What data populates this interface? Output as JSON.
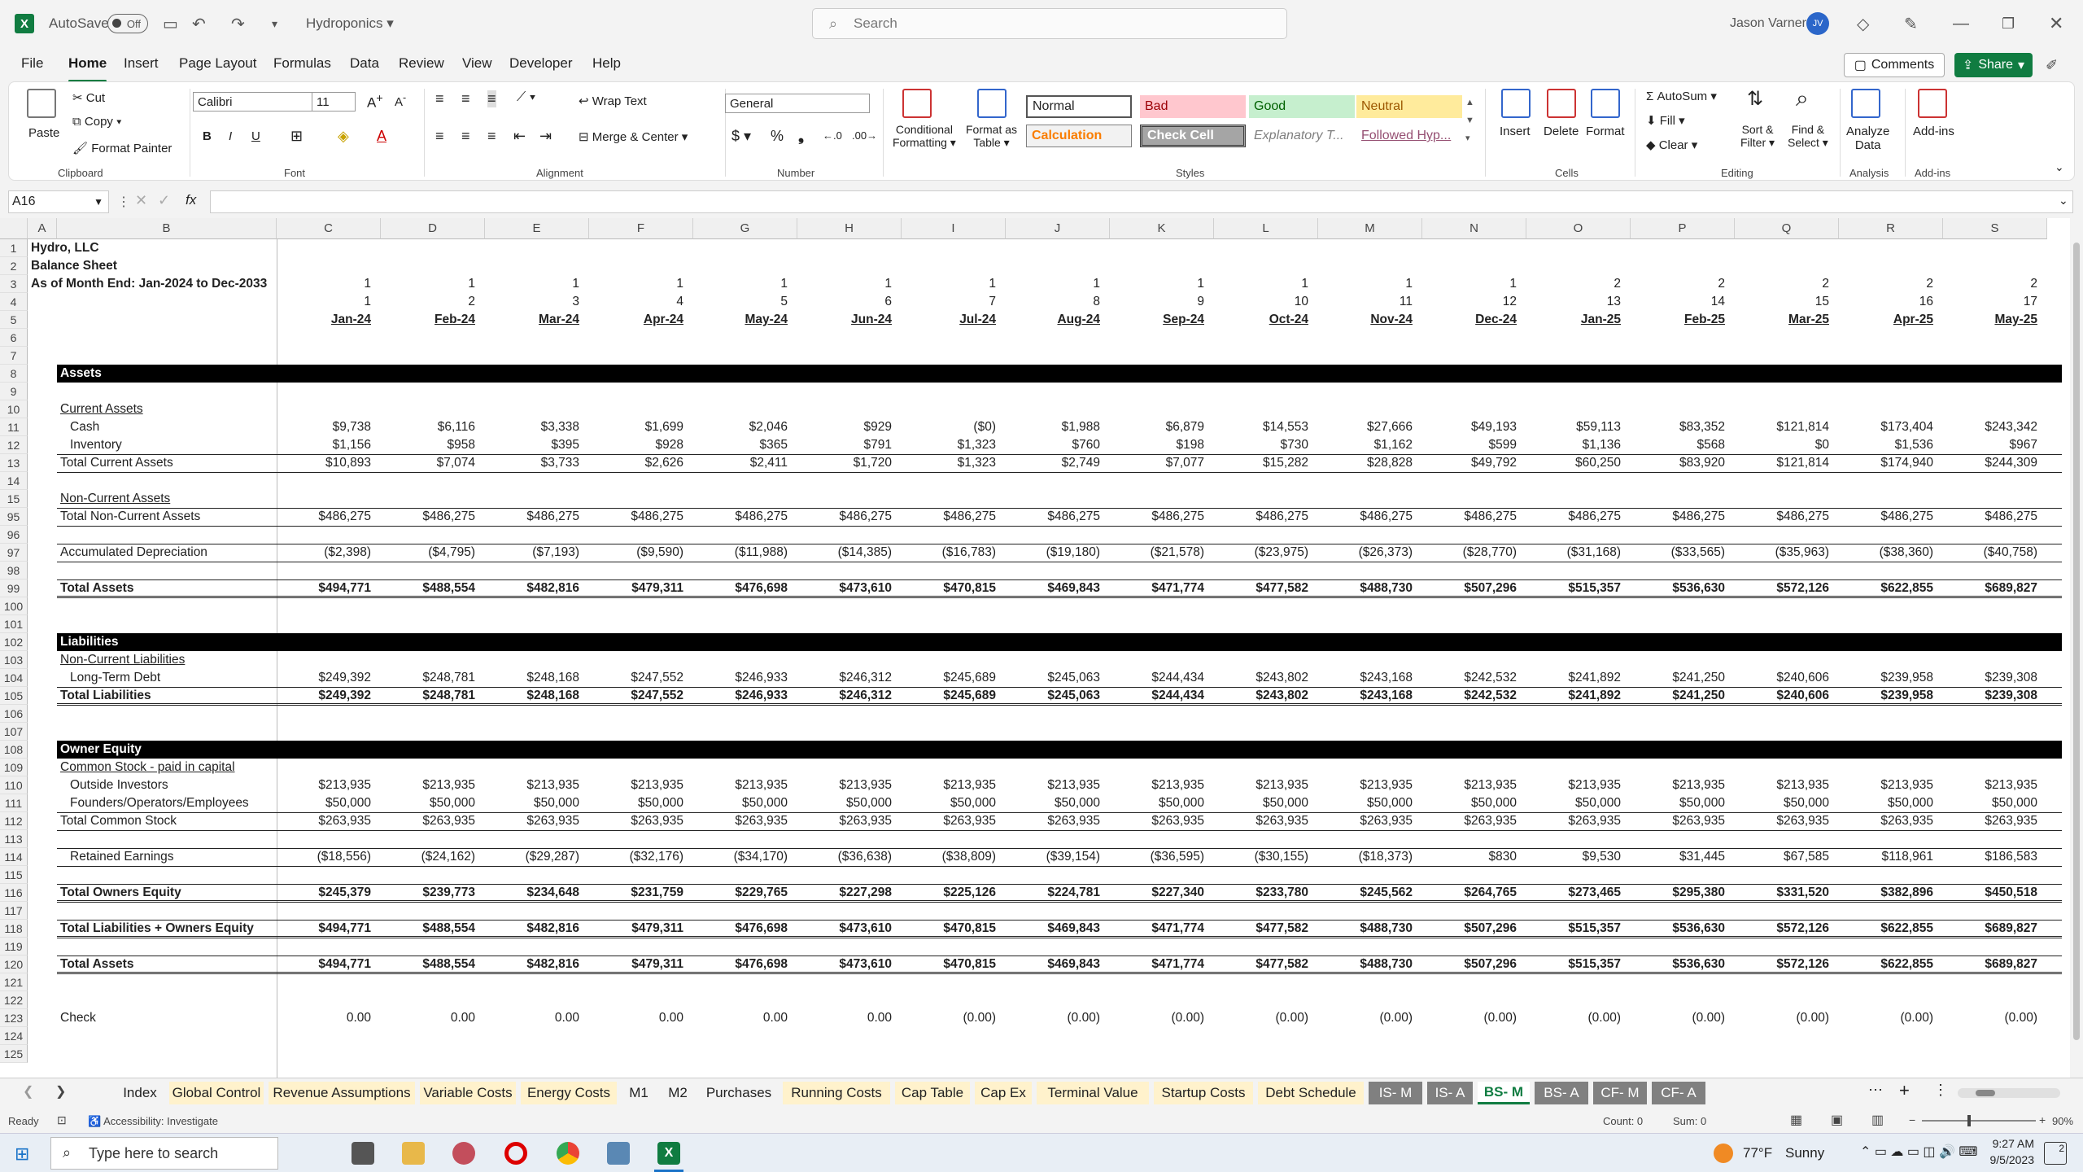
{
  "titlebar": {
    "autosave": "AutoSave",
    "autosave_state": "Off",
    "doc_title": "Hydroponics",
    "search_placeholder": "Search",
    "user_name": "Jason Varner",
    "user_initials": "JV"
  },
  "menu": {
    "file": "File",
    "home": "Home",
    "insert": "Insert",
    "page_layout": "Page Layout",
    "formulas": "Formulas",
    "data": "Data",
    "review": "Review",
    "view": "View",
    "developer": "Developer",
    "help": "Help",
    "comments": "Comments",
    "share": "Share"
  },
  "ribbon": {
    "clipboard": {
      "paste": "Paste",
      "cut": "Cut",
      "copy": "Copy",
      "format_painter": "Format Painter",
      "group": "Clipboard"
    },
    "font": {
      "name": "Calibri",
      "size": "11",
      "group": "Font"
    },
    "alignment": {
      "wrap": "Wrap Text",
      "merge": "Merge & Center",
      "group": "Alignment"
    },
    "number": {
      "format": "General",
      "group": "Number"
    },
    "styles": {
      "conditional": "Conditional",
      "conditional2": "Formatting",
      "format_table": "Format as",
      "format_table2": "Table",
      "normal": "Normal",
      "bad": "Bad",
      "good": "Good",
      "neutral": "Neutral",
      "calculation": "Calculation",
      "check_cell": "Check Cell",
      "explanatory": "Explanatory T...",
      "followed": "Followed Hyp...",
      "group": "Styles"
    },
    "cells": {
      "insert": "Insert",
      "delete": "Delete",
      "format": "Format",
      "group": "Cells"
    },
    "editing": {
      "autosum": "AutoSum",
      "fill": "Fill",
      "clear": "Clear",
      "sort": "Sort &",
      "sort2": "Filter",
      "find": "Find &",
      "find2": "Select",
      "group": "Editing"
    },
    "analysis": {
      "analyze": "Analyze",
      "analyze2": "Data",
      "group": "Analysis"
    },
    "addins": {
      "label": "Add-ins",
      "group": "Add-ins"
    }
  },
  "formula": {
    "namebox": "A16",
    "fx": "fx"
  },
  "sheet": {
    "cols": [
      "A",
      "B",
      "C",
      "D",
      "E",
      "F",
      "G",
      "H",
      "I",
      "J",
      "K",
      "L",
      "M",
      "N",
      "O",
      "P",
      "Q",
      "R",
      "S"
    ],
    "rows": [
      "1",
      "2",
      "3",
      "4",
      "5",
      "6",
      "7",
      "8",
      "9",
      "10",
      "11",
      "12",
      "13",
      "14",
      "15",
      "95",
      "96",
      "97",
      "98",
      "99",
      "100",
      "101",
      "102",
      "103",
      "104",
      "105",
      "106",
      "107",
      "108",
      "109",
      "110",
      "111",
      "112",
      "113",
      "114",
      "115",
      "116",
      "117",
      "118",
      "119",
      "120",
      "121",
      "122",
      "123",
      "124",
      "125"
    ],
    "title1": "Hydro, LLC",
    "title2": "Balance Sheet",
    "title3": "As of Month End: Jan-2024 to Dec-2033",
    "year_idx": [
      "1",
      "1",
      "1",
      "1",
      "1",
      "1",
      "1",
      "1",
      "1",
      "1",
      "1",
      "1",
      "2",
      "2",
      "2",
      "2",
      "2"
    ],
    "month_idx": [
      "1",
      "2",
      "3",
      "4",
      "5",
      "6",
      "7",
      "8",
      "9",
      "10",
      "11",
      "12",
      "13",
      "14",
      "15",
      "16",
      "17"
    ],
    "months": [
      "Jan-24",
      "Feb-24",
      "Mar-24",
      "Apr-24",
      "May-24",
      "Jun-24",
      "Jul-24",
      "Aug-24",
      "Sep-24",
      "Oct-24",
      "Nov-24",
      "Dec-24",
      "Jan-25",
      "Feb-25",
      "Mar-25",
      "Apr-25",
      "May-25"
    ],
    "assets": "Assets",
    "current_assets": "Current Assets",
    "cash": "Cash",
    "inventory": "Inventory",
    "total_current": "Total Current Assets",
    "noncurrent": "Non-Current Assets",
    "total_noncurrent": "Total Non-Current Assets",
    "accum_dep": "Accumulated Depreciation",
    "total_assets": "Total Assets",
    "liabilities": "Liabilities",
    "noncurrent_liab": "Non-Current Liabilities",
    "lt_debt": "Long-Term Debt",
    "total_liab": "Total Liabilities",
    "equity": "Owner Equity",
    "common": "Common Stock - paid in capital",
    "outside": "Outside Investors",
    "founders": "Founders/Operators/Employees",
    "total_common": "Total Common Stock",
    "retained": "Retained Earnings",
    "total_owners": "Total Owners Equity",
    "total_le": "Total Liabilities + Owners Equity",
    "check": "Check",
    "v_cash": [
      "$9,738",
      "$6,116",
      "$3,338",
      "$1,699",
      "$2,046",
      "$929",
      "($0)",
      "$1,988",
      "$6,879",
      "$14,553",
      "$27,666",
      "$49,193",
      "$59,113",
      "$83,352",
      "$121,814",
      "$173,404",
      "$243,342"
    ],
    "v_inventory": [
      "$1,156",
      "$958",
      "$395",
      "$928",
      "$365",
      "$791",
      "$1,323",
      "$760",
      "$198",
      "$730",
      "$1,162",
      "$599",
      "$1,136",
      "$568",
      "$0",
      "$1,536",
      "$967"
    ],
    "v_total_current": [
      "$10,893",
      "$7,074",
      "$3,733",
      "$2,626",
      "$2,411",
      "$1,720",
      "$1,323",
      "$2,749",
      "$7,077",
      "$15,282",
      "$28,828",
      "$49,792",
      "$60,250",
      "$83,920",
      "$121,814",
      "$174,940",
      "$244,309"
    ],
    "v_total_noncurrent": [
      "$486,275",
      "$486,275",
      "$486,275",
      "$486,275",
      "$486,275",
      "$486,275",
      "$486,275",
      "$486,275",
      "$486,275",
      "$486,275",
      "$486,275",
      "$486,275",
      "$486,275",
      "$486,275",
      "$486,275",
      "$486,275",
      "$486,275"
    ],
    "v_accum_dep": [
      "($2,398)",
      "($4,795)",
      "($7,193)",
      "($9,590)",
      "($11,988)",
      "($14,385)",
      "($16,783)",
      "($19,180)",
      "($21,578)",
      "($23,975)",
      "($26,373)",
      "($28,770)",
      "($31,168)",
      "($33,565)",
      "($35,963)",
      "($38,360)",
      "($40,758)"
    ],
    "v_total_assets": [
      "$494,771",
      "$488,554",
      "$482,816",
      "$479,311",
      "$476,698",
      "$473,610",
      "$470,815",
      "$469,843",
      "$471,774",
      "$477,582",
      "$488,730",
      "$507,296",
      "$515,357",
      "$536,630",
      "$572,126",
      "$622,855",
      "$689,827"
    ],
    "v_lt_debt": [
      "$249,392",
      "$248,781",
      "$248,168",
      "$247,552",
      "$246,933",
      "$246,312",
      "$245,689",
      "$245,063",
      "$244,434",
      "$243,802",
      "$243,168",
      "$242,532",
      "$241,892",
      "$241,250",
      "$240,606",
      "$239,958",
      "$239,308"
    ],
    "v_outside": [
      "$213,935",
      "$213,935",
      "$213,935",
      "$213,935",
      "$213,935",
      "$213,935",
      "$213,935",
      "$213,935",
      "$213,935",
      "$213,935",
      "$213,935",
      "$213,935",
      "$213,935",
      "$213,935",
      "$213,935",
      "$213,935",
      "$213,935"
    ],
    "v_founders": [
      "$50,000",
      "$50,000",
      "$50,000",
      "$50,000",
      "$50,000",
      "$50,000",
      "$50,000",
      "$50,000",
      "$50,000",
      "$50,000",
      "$50,000",
      "$50,000",
      "$50,000",
      "$50,000",
      "$50,000",
      "$50,000",
      "$50,000"
    ],
    "v_total_common": [
      "$263,935",
      "$263,935",
      "$263,935",
      "$263,935",
      "$263,935",
      "$263,935",
      "$263,935",
      "$263,935",
      "$263,935",
      "$263,935",
      "$263,935",
      "$263,935",
      "$263,935",
      "$263,935",
      "$263,935",
      "$263,935",
      "$263,935"
    ],
    "v_retained": [
      "($18,556)",
      "($24,162)",
      "($29,287)",
      "($32,176)",
      "($34,170)",
      "($36,638)",
      "($38,809)",
      "($39,154)",
      "($36,595)",
      "($30,155)",
      "($18,373)",
      "$830",
      "$9,530",
      "$31,445",
      "$67,585",
      "$118,961",
      "$186,583"
    ],
    "v_total_owners": [
      "$245,379",
      "$239,773",
      "$234,648",
      "$231,759",
      "$229,765",
      "$227,298",
      "$225,126",
      "$224,781",
      "$227,340",
      "$233,780",
      "$245,562",
      "$264,765",
      "$273,465",
      "$295,380",
      "$331,520",
      "$382,896",
      "$450,518"
    ],
    "v_check": [
      "0.00",
      "0.00",
      "0.00",
      "0.00",
      "0.00",
      "0.00",
      "(0.00)",
      "(0.00)",
      "(0.00)",
      "(0.00)",
      "(0.00)",
      "(0.00)",
      "(0.00)",
      "(0.00)",
      "(0.00)",
      "(0.00)",
      "(0.00)"
    ]
  },
  "tabs": [
    "Index",
    "Global Control",
    "Revenue Assumptions",
    "Variable Costs",
    "Energy Costs",
    "M1",
    "M2",
    "Purchases",
    "Running Costs",
    "Cap Table",
    "Cap Ex",
    "Terminal Value",
    "Startup Costs",
    "Debt Schedule",
    "IS- M",
    "IS- A",
    "BS- M",
    "BS- A",
    "CF- M",
    "CF- A"
  ],
  "tab_colors": [
    "#f3f3f3",
    "#fff2cc",
    "#fff2cc",
    "#fff2cc",
    "#fff2cc",
    "#f3f3f3",
    "#f3f3f3",
    "#f3f3f3",
    "#fff2cc",
    "#fff2cc",
    "#fff2cc",
    "#fff2cc",
    "#fff2cc",
    "#fff2cc",
    "#808080",
    "#808080",
    "#ffffff",
    "#808080",
    "#808080",
    "#808080"
  ],
  "status": {
    "ready": "Ready",
    "accessibility": "Accessibility: Investigate",
    "count": "Count: 0",
    "sum": "Sum: 0",
    "zoom": "90%"
  },
  "taskbar": {
    "search": "Type here to search",
    "weather_temp": "77°F",
    "weather_text": "Sunny",
    "time": "9:27 AM",
    "date": "9/5/2023",
    "notif": "2"
  }
}
